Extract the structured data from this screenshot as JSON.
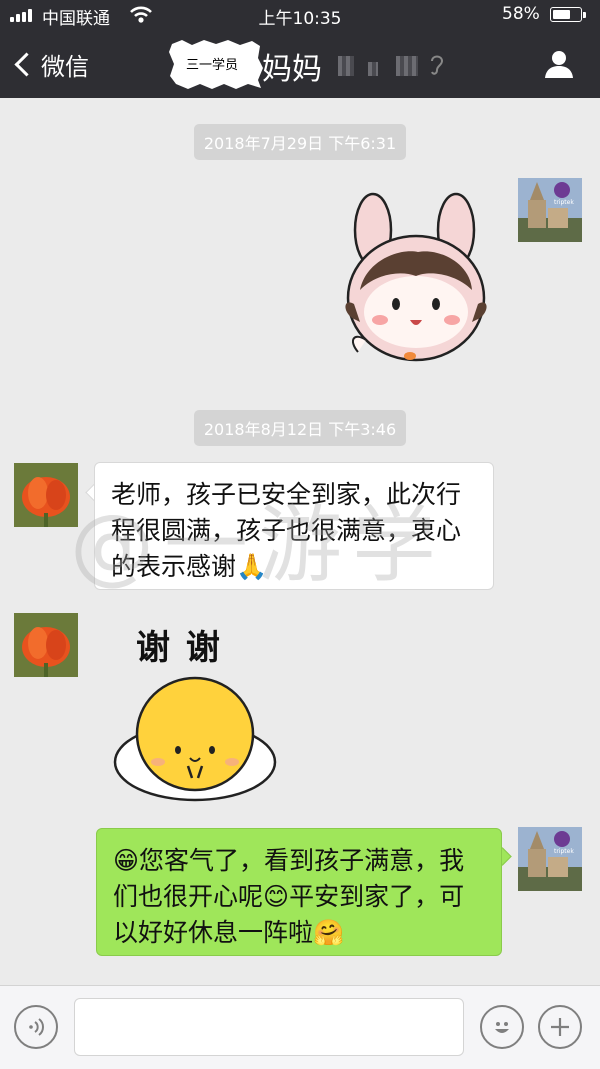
{
  "status_bar": {
    "carrier": "中国联通",
    "time": "上午10:35",
    "battery": "58%",
    "battery_level": 0.58
  },
  "nav": {
    "back_label": "微信",
    "title_tag": "三一学员",
    "title_name": "妈妈"
  },
  "timestamps": [
    "2018年7月29日 下午6:31",
    "2018年8月12日 下午3:46"
  ],
  "messages": [
    {
      "sender": "teacher",
      "type": "sticker",
      "sticker": "bunny-girl-sticker"
    },
    {
      "sender": "parent",
      "type": "text",
      "text": "老师，孩子已安全到家，此次行程很圆满，孩子也很满意，衷心的表示感谢🙏"
    },
    {
      "sender": "parent",
      "type": "sticker",
      "sticker": "thank-you-sticker",
      "caption": "谢 谢"
    },
    {
      "sender": "teacher",
      "type": "text",
      "text": "😁您客气了，看到孩子满意，我们也很开心呢😊平安到家了，可以好好休息一阵啦🤗"
    }
  ],
  "watermark": "@一游学",
  "colors": {
    "nav_bg": "#2e2e33",
    "chat_bg": "#ebebeb",
    "outgoing_bubble": "#9fe65a",
    "incoming_bubble": "#ffffff"
  },
  "icons": [
    "signal-icon",
    "wifi-icon",
    "battery-icon",
    "back-chevron-icon",
    "ear-icon",
    "profile-icon",
    "voice-icon",
    "emoji-icon",
    "plus-icon"
  ]
}
